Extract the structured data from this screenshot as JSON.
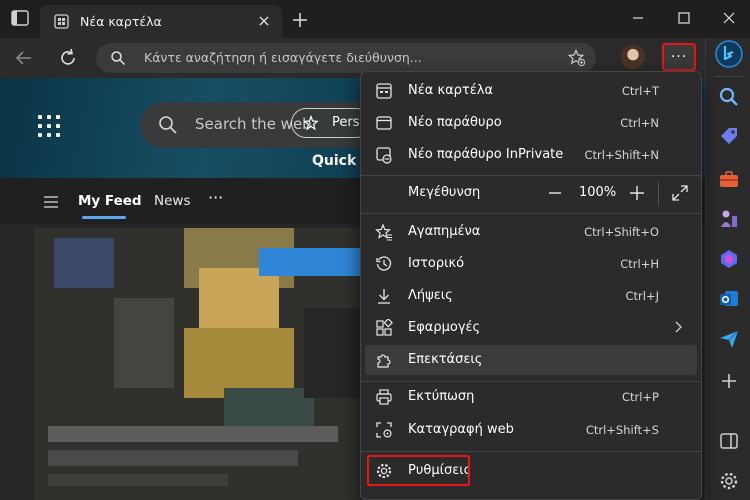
{
  "titlebar": {
    "tab_title": "Νέα καρτέλα"
  },
  "toolbar": {
    "address_placeholder": "Κάντε αναζήτηση ή εισαγάγετε διεύθυνση..."
  },
  "page": {
    "search_placeholder": "Search the web",
    "quick_links_label": "Quick lin",
    "feed_tabs": [
      {
        "label": "My Feed"
      },
      {
        "label": "News"
      }
    ],
    "feed_more": "···",
    "personalize_label": "Perso"
  },
  "menu": {
    "items": [
      {
        "label": "Νέα καρτέλα",
        "shortcut": "Ctrl+T",
        "icon": "new-tab-icon"
      },
      {
        "label": "Νέο παράθυρο",
        "shortcut": "Ctrl+N",
        "icon": "window-icon"
      },
      {
        "label": "Νέο παράθυρο InPrivate",
        "shortcut": "Ctrl+Shift+N",
        "icon": "inprivate-icon"
      },
      {
        "label": "Αγαπημένα",
        "shortcut": "Ctrl+Shift+O",
        "icon": "favorites-icon"
      },
      {
        "label": "Ιστορικό",
        "shortcut": "Ctrl+H",
        "icon": "history-icon"
      },
      {
        "label": "Λήψεις",
        "shortcut": "Ctrl+J",
        "icon": "download-icon"
      },
      {
        "label": "Εφαρμογές",
        "shortcut": "",
        "icon": "apps-icon"
      },
      {
        "label": "Επεκτάσεις",
        "shortcut": "",
        "icon": "extensions-icon"
      },
      {
        "label": "Εκτύπωση",
        "shortcut": "Ctrl+P",
        "icon": "print-icon"
      },
      {
        "label": "Καταγραφή web",
        "shortcut": "Ctrl+Shift+S",
        "icon": "web-capture-icon"
      },
      {
        "label": "Ρυθμίσεις",
        "shortcut": "",
        "icon": "settings-icon"
      }
    ],
    "zoom": {
      "label": "Μεγέθυνση",
      "value": "100%"
    }
  },
  "colors": {
    "highlight_box": "#e3161a",
    "accent": "#5aa7f0",
    "menu_bg": "#2b2b2b"
  }
}
